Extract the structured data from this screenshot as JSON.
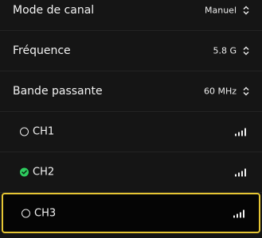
{
  "settings": {
    "channel_mode": {
      "label": "Mode de canal",
      "value": "Manuel"
    },
    "frequency": {
      "label": "Fréquence",
      "value": "5.8 G"
    },
    "bandwidth": {
      "label": "Bande passante",
      "value": "60 MHz"
    }
  },
  "channels": [
    {
      "label": "CH1",
      "selected": false,
      "signal_bars": 4
    },
    {
      "label": "CH2",
      "selected": true,
      "signal_bars": 4
    },
    {
      "label": "CH3",
      "selected": false,
      "signal_bars": 4
    }
  ],
  "colors": {
    "focus_border": "#e6c634",
    "check_green": "#2ecc5f"
  },
  "icons": {
    "dropdown": "chevron-up-down-icon",
    "signal": "signal-strength-icon",
    "radio_selected": "check-circle-icon",
    "radio_unselected": "radio-empty-icon"
  }
}
